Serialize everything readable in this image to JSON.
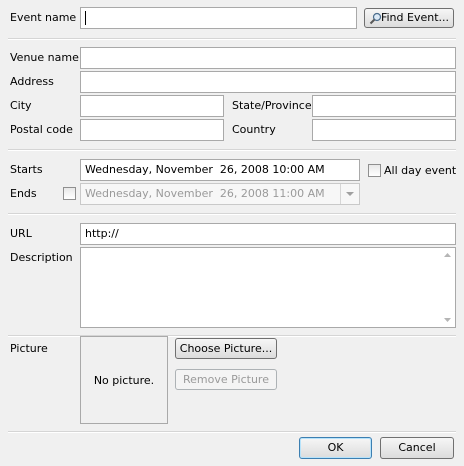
{
  "event": {
    "name_label": "Event name",
    "name_value": "",
    "find_button": "Find Event..."
  },
  "venue": {
    "name_label": "Venue name",
    "address_label": "Address",
    "city_label": "City",
    "state_label": "State/Province",
    "postal_label": "Postal code",
    "country_label": "Country"
  },
  "schedule": {
    "starts_label": "Starts",
    "starts_value": "Wednesday, November  26, 2008 10:00 AM",
    "all_day_label": "All day event",
    "all_day_checked": false,
    "ends_label": "Ends",
    "ends_checked": false,
    "ends_value": "Wednesday, November  26, 2008 11:00 AM"
  },
  "details": {
    "url_label": "URL",
    "url_value": "http://",
    "description_label": "Description",
    "description_value": ""
  },
  "picture": {
    "label": "Picture",
    "placeholder": "No picture.",
    "choose_button": "Choose Picture...",
    "remove_button": "Remove Picture"
  },
  "footer": {
    "ok_button": "OK",
    "cancel_button": "Cancel"
  },
  "icons": {
    "find_icon": "magnifier-icon",
    "dropdown_icon": "chevron-down-icon",
    "scroll_up_icon": "scroll-up-arrow-icon",
    "scroll_down_icon": "scroll-down-arrow-icon"
  }
}
